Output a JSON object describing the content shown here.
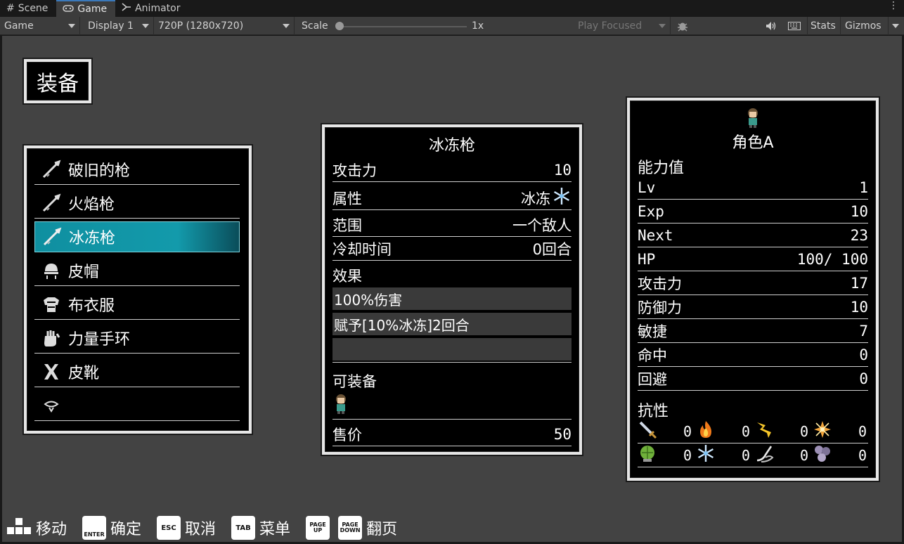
{
  "editor": {
    "tabs": [
      {
        "label": "Scene",
        "icon": "grid-icon"
      },
      {
        "label": "Game",
        "icon": "gamepad-icon",
        "active": true
      },
      {
        "label": "Animator",
        "icon": "animator-icon"
      }
    ],
    "toolbar": {
      "view_mode": "Game",
      "display": "Display 1",
      "resolution": "720P (1280x720)",
      "scale_label": "Scale",
      "scale_value": "1x",
      "play_focused": "Play Focused",
      "stats": "Stats",
      "gizmos": "Gizmos"
    }
  },
  "game": {
    "title": "装备",
    "equipment_list": [
      {
        "label": "破旧的枪",
        "icon": "gun-icon"
      },
      {
        "label": "火焰枪",
        "icon": "gun-icon"
      },
      {
        "label": "冰冻枪",
        "icon": "gun-icon",
        "selected": true
      },
      {
        "label": "皮帽",
        "icon": "helmet-icon"
      },
      {
        "label": "布衣服",
        "icon": "armor-icon"
      },
      {
        "label": "力量手环",
        "icon": "gauntlet-icon"
      },
      {
        "label": "皮靴",
        "icon": "boots-icon"
      },
      {
        "label": "",
        "icon": "empty-ring-icon"
      }
    ],
    "detail": {
      "name": "冰冻枪",
      "attack_label": "攻击力",
      "attack_value": "10",
      "attribute_label": "属性",
      "attribute_value": "冰冻",
      "range_label": "范围",
      "range_value": "一个敌人",
      "cooldown_label": "冷却时间",
      "cooldown_value": "0回合",
      "effects_label": "效果",
      "effects": [
        "100%伤害",
        "赋予[10%冰冻]2回合",
        ""
      ],
      "equippable_label": "可装备",
      "price_label": "售价",
      "price_value": "50"
    },
    "status": {
      "name": "角色A",
      "stats_header": "能力值",
      "rows": [
        {
          "label": "Lv",
          "value": "1"
        },
        {
          "label": "Exp",
          "value": "10"
        },
        {
          "label": "Next",
          "value": "23"
        },
        {
          "label": "HP",
          "value": "100/ 100"
        },
        {
          "label": "攻击力",
          "value": "17"
        },
        {
          "label": "防御力",
          "value": "10"
        },
        {
          "label": "敏捷",
          "value": "7"
        },
        {
          "label": "命中",
          "value": "0"
        },
        {
          "label": "回避",
          "value": "0"
        }
      ],
      "resist_header": "抗性",
      "resist": [
        [
          {
            "icon": "sword-icon",
            "value": "0"
          },
          {
            "icon": "fire-icon",
            "value": "0"
          },
          {
            "icon": "lightning-icon",
            "value": "0"
          },
          {
            "icon": "burst-icon",
            "value": "0"
          }
        ],
        [
          {
            "icon": "poison-icon",
            "value": "0"
          },
          {
            "icon": "ice-icon",
            "value": "0"
          },
          {
            "icon": "wind-icon",
            "value": "0"
          },
          {
            "icon": "orbs-icon",
            "value": "0"
          }
        ]
      ]
    },
    "help": [
      {
        "key": "",
        "label": "移动",
        "icon": "dpad-icon"
      },
      {
        "key": "ENTER",
        "label": "确定"
      },
      {
        "key": "ESC",
        "label": "取消"
      },
      {
        "key": "TAB",
        "label": "菜单"
      },
      {
        "key": "PAGE UP",
        "label": ""
      },
      {
        "key": "PAGE DOWN",
        "label": "翻页"
      }
    ]
  }
}
